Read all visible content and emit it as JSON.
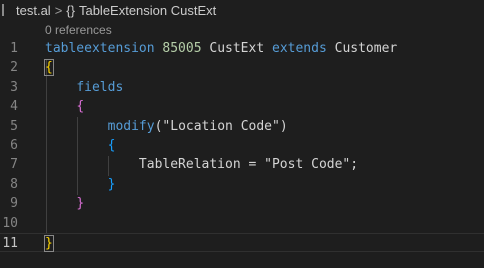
{
  "breadcrumb": {
    "file": "test.al",
    "separator": ">",
    "symbol_icon": "{}",
    "symbol": "TableExtension CustExt"
  },
  "codelens": "0 references",
  "lines": [
    {
      "num": "1",
      "tokens": [
        {
          "t": "tableextension",
          "c": "kw"
        },
        {
          "t": " ",
          "c": "punc"
        },
        {
          "t": "85005",
          "c": "num"
        },
        {
          "t": " CustExt ",
          "c": "punc"
        },
        {
          "t": "extends",
          "c": "kw"
        },
        {
          "t": " Customer",
          "c": "punc"
        }
      ]
    },
    {
      "num": "2",
      "tokens": [
        {
          "t": "{",
          "c": "b1 bracket-box"
        }
      ]
    },
    {
      "num": "3",
      "tokens": [
        {
          "t": "    ",
          "c": "punc"
        },
        {
          "t": "fields",
          "c": "kw"
        }
      ]
    },
    {
      "num": "4",
      "tokens": [
        {
          "t": "    ",
          "c": "punc"
        },
        {
          "t": "{",
          "c": "b2"
        }
      ]
    },
    {
      "num": "5",
      "tokens": [
        {
          "t": "        ",
          "c": "punc"
        },
        {
          "t": "modify",
          "c": "kw"
        },
        {
          "t": "(",
          "c": "punc"
        },
        {
          "t": "\"Location Code\"",
          "c": "punc"
        },
        {
          "t": ")",
          "c": "punc"
        }
      ]
    },
    {
      "num": "6",
      "tokens": [
        {
          "t": "        ",
          "c": "punc"
        },
        {
          "t": "{",
          "c": "b3"
        }
      ]
    },
    {
      "num": "7",
      "tokens": [
        {
          "t": "            TableRelation = ",
          "c": "punc"
        },
        {
          "t": "\"Post Code\"",
          "c": "punc"
        },
        {
          "t": ";",
          "c": "punc"
        }
      ]
    },
    {
      "num": "8",
      "tokens": [
        {
          "t": "        ",
          "c": "punc"
        },
        {
          "t": "}",
          "c": "b3"
        }
      ]
    },
    {
      "num": "9",
      "tokens": [
        {
          "t": "    ",
          "c": "punc"
        },
        {
          "t": "}",
          "c": "b2"
        }
      ]
    },
    {
      "num": "10",
      "tokens": []
    },
    {
      "num": "11",
      "tokens": [
        {
          "t": "}",
          "c": "b1 bracket-box"
        }
      ],
      "current": true
    }
  ]
}
